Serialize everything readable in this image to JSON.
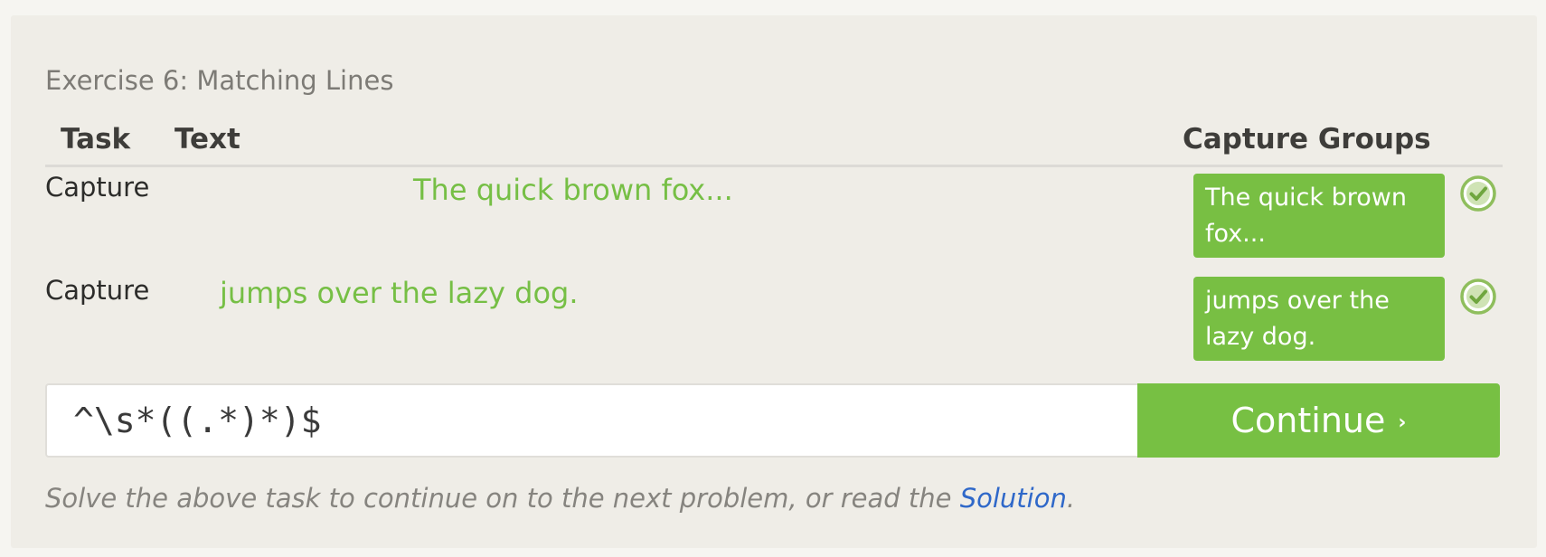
{
  "exercise": {
    "title": "Exercise 6: Matching Lines"
  },
  "table": {
    "headers": {
      "task": "Task",
      "text": "Text",
      "capture_groups": "Capture Groups"
    },
    "rows": [
      {
        "task": "Capture",
        "text": "The quick brown fox...",
        "capture_group": "The quick brown fox...",
        "status_icon": "check-circle-icon"
      },
      {
        "task": "Capture",
        "text": "jumps over the lazy dog.",
        "capture_group": "jumps over the lazy dog.",
        "status_icon": "check-circle-icon"
      }
    ]
  },
  "regex_input": {
    "value": "^\\s*((.*)*)$"
  },
  "continue_button": {
    "label": "Continue",
    "chevron": "›"
  },
  "hint": {
    "prefix": "Solve the above task to continue on to the next problem, or read the ",
    "link": "Solution",
    "suffix": "."
  },
  "colors": {
    "accent_green": "#77c043",
    "link_blue": "#2f68c9",
    "panel_background": "#efede7"
  }
}
